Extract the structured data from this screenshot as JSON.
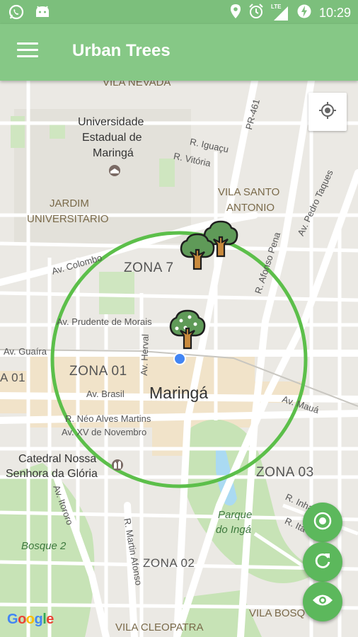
{
  "status": {
    "time": "10:29",
    "lte": "LTE"
  },
  "appbar": {
    "title": "Urban Trees",
    "menu_icon": "hamburger-menu-icon"
  },
  "map": {
    "zones": [
      "ZONA 7",
      "ZONA 01",
      "ZONA 03",
      "ZONA 02",
      "A 01"
    ],
    "neighborhoods": {
      "vila_nevada": "VILA NEVADA",
      "jardim": "JARDIM",
      "universitario": "UNIVERSITARIO",
      "vila_santo": "VILA SANTO",
      "antonio": "ANTONIO",
      "vila_bosque": "VILA BOSQ",
      "vila_cleopatra": "VILA CLEOPATRA"
    },
    "streets": {
      "pr461": "PR-461",
      "iguacu": "R. Iguaçu",
      "vitoria": "R. Vitória",
      "pedro_taques": "Av. Pedro Taques",
      "colombo": "Av. Colombo",
      "afonso_pena": "R. Afonso Pena",
      "prudente": "Av. Prudente de Morais",
      "guaira": "Av. Guaíra",
      "herval": "Av. Herval",
      "brasil": "Av. Brasil",
      "neo_alves": "R. Néo Alves Martins",
      "xv_novembro": "Av. XV de Novembro",
      "maua": "Av. Mauá",
      "itororo": "Av. Itororo",
      "martin_afonso": "R. Martin Afonso",
      "inhau": "R. Inhaú",
      "ita": "R. Ita"
    },
    "pois": {
      "universidade_1": "Universidade",
      "universidade_2": "Estadual de",
      "universidade_3": "Maringá",
      "catedral_1": "Catedral Nossa",
      "catedral_2": "Senhora da Glória"
    },
    "city": "Maringá",
    "parks": {
      "parque_1": "Parque",
      "parque_2": "do Ingá",
      "bosque": "Bosque 2"
    },
    "radius_circle_color": "#5cbf4a",
    "user_location_color": "#4285f4"
  },
  "buttons": {
    "my_location": "crosshair-location-icon",
    "fab_target": "target-icon",
    "fab_refresh": "refresh-icon",
    "fab_visibility": "eye-icon"
  },
  "attribution": "Google"
}
